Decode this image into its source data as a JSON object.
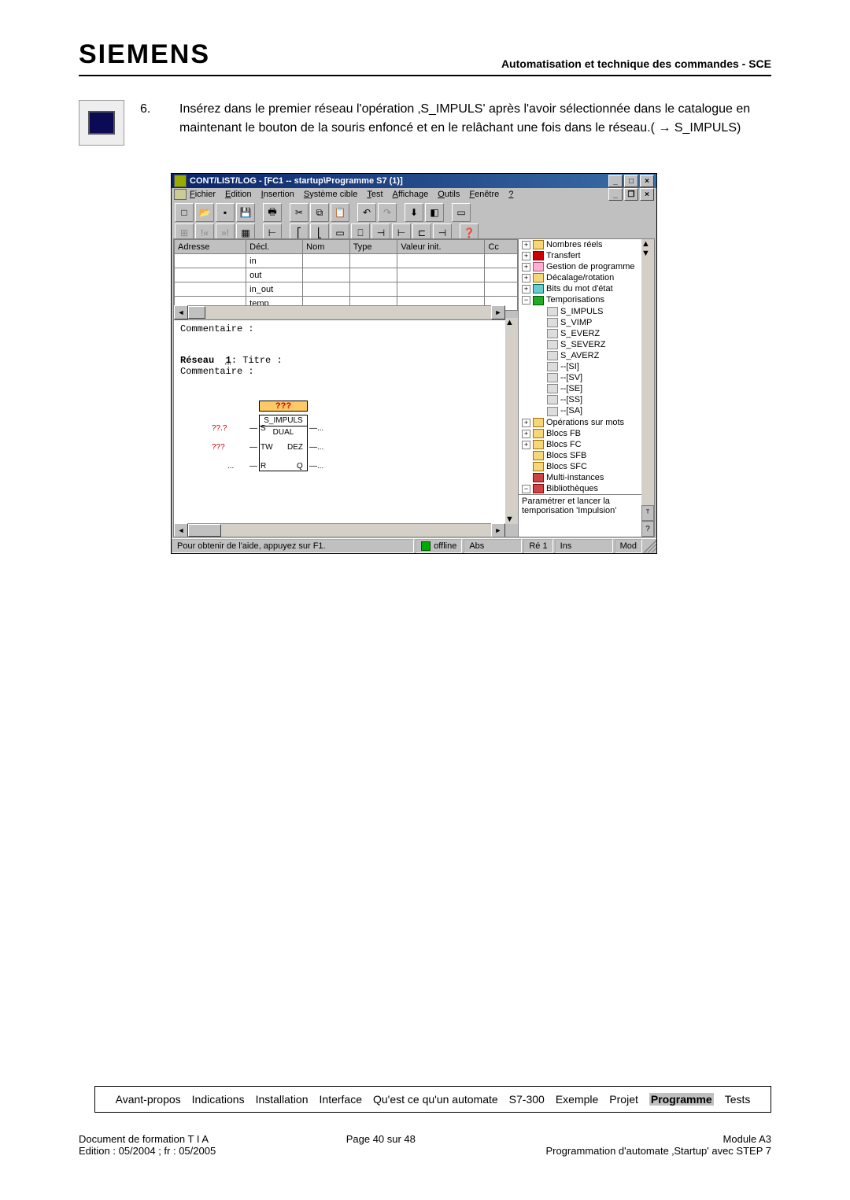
{
  "header": {
    "brand": "SIEMENS",
    "right": "Automatisation et technique des commandes - SCE"
  },
  "step": {
    "number": "6.",
    "text": "Insérez dans le premier réseau l'opération ‚S_IMPULS' après l'avoir sélectionnée dans le catalogue en maintenant le bouton de la souris enfoncé et en le relâchant une fois dans le réseau.( → S_IMPULS)"
  },
  "window": {
    "title": "CONT/LIST/LOG - [FC1 -- startup\\Programme S7 (1)]",
    "mdi_controls": {
      "min": "_",
      "restore": "❐",
      "close": "×"
    },
    "controls": {
      "min": "_",
      "max": "□",
      "close": "×"
    },
    "menus": [
      "Fichier",
      "Edition",
      "Insertion",
      "Système cible",
      "Test",
      "Affichage",
      "Outils",
      "Fenêtre",
      "?"
    ],
    "var_header": [
      "Adresse",
      "Décl.",
      "Nom",
      "Type",
      "Valeur init.",
      "Cc"
    ],
    "var_rows": [
      {
        "decl": "in"
      },
      {
        "decl": "out"
      },
      {
        "decl": "in_out"
      },
      {
        "decl": "temp"
      }
    ],
    "net": {
      "comment_label": "Commentaire :",
      "reseau_label": "Réseau",
      "reseau_num": "1",
      "title_label": "Titre :",
      "comment2_label": "Commentaire :",
      "fb": {
        "top": "???",
        "name": "S_IMPULS",
        "sub": "DUAL",
        "left_s": "??.?",
        "port_s": "S",
        "left_tw": "???",
        "port_tw": "TW",
        "port_dez": "DEZ",
        "port_r": "R",
        "port_q": "Q",
        "out1": "...",
        "out2": "...",
        "out3": "..."
      }
    },
    "tree": {
      "items": [
        {
          "exp": "+",
          "icon": "ic-fold",
          "label": "Nombres réels"
        },
        {
          "exp": "+",
          "icon": "ic-red",
          "label": "Transfert"
        },
        {
          "exp": "+",
          "icon": "ic-pink",
          "label": "Gestion de programme"
        },
        {
          "exp": "+",
          "icon": "ic-fold",
          "label": "Décalage/rotation"
        },
        {
          "exp": "+",
          "icon": "ic-cyan",
          "label": "Bits du mot d'état"
        },
        {
          "exp": "−",
          "icon": "ic-grn",
          "label": "Temporisations",
          "children": [
            {
              "icon": "ic-item",
              "label": "S_IMPULS"
            },
            {
              "icon": "ic-item",
              "label": "S_VIMP"
            },
            {
              "icon": "ic-item",
              "label": "S_EVERZ"
            },
            {
              "icon": "ic-item",
              "label": "S_SEVERZ"
            },
            {
              "icon": "ic-item",
              "label": "S_AVERZ"
            },
            {
              "icon": "ic-item",
              "label": "--[SI]"
            },
            {
              "icon": "ic-item",
              "label": "--[SV]"
            },
            {
              "icon": "ic-item",
              "label": "--[SE]"
            },
            {
              "icon": "ic-item",
              "label": "--[SS]"
            },
            {
              "icon": "ic-item",
              "label": "--[SA]"
            }
          ]
        },
        {
          "exp": "+",
          "icon": "ic-fold",
          "label": "Opérations sur mots"
        },
        {
          "exp": "+",
          "icon": "ic-fold",
          "label": "Blocs FB"
        },
        {
          "exp": "+",
          "icon": "ic-fold",
          "label": "Blocs FC"
        },
        {
          "exp": "",
          "icon": "ic-fold",
          "label": "Blocs SFB"
        },
        {
          "exp": "",
          "icon": "ic-fold",
          "label": "Blocs SFC"
        },
        {
          "exp": "",
          "icon": "ic-lib",
          "label": "Multi-instances"
        },
        {
          "exp": "−",
          "icon": "ic-lib",
          "label": "Bibliothèques"
        }
      ],
      "hint": "Paramétrer et lancer la temporisation 'Impulsion'"
    },
    "status": {
      "help": "Pour obtenir de l'aide, appuyez sur F1.",
      "offline": "offline",
      "abs": "Abs",
      "re": "Ré 1",
      "ins": "Ins",
      "mod": "Mod"
    }
  },
  "footer_nav": [
    "Avant-propos",
    "Indications",
    "Installation",
    "Interface",
    "Qu'est ce qu'un automate",
    "S7-300",
    "Exemple",
    "Projet",
    "Programme",
    "Tests"
  ],
  "footer_nav_active": "Programme",
  "doc_footer": {
    "l1": "Document de formation T I A",
    "l2": "Edition : 05/2004 ; fr : 05/2005",
    "c": "Page 40 sur 48",
    "r1": "Module A3",
    "r2": "Programmation d'automate ‚Startup' avec STEP 7"
  }
}
